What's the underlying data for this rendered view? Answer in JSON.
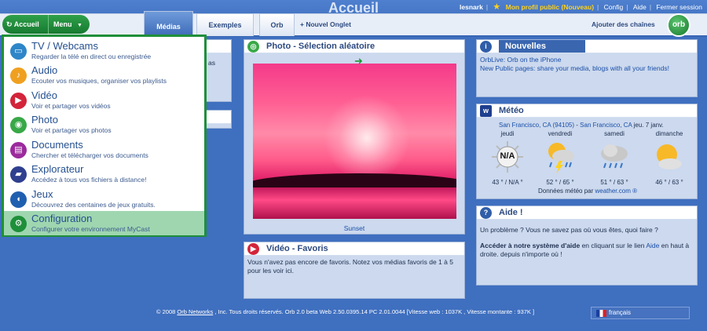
{
  "header": {
    "title": "Accueil",
    "user": "lesnark",
    "profile": "Mon profil public (Nouveau)",
    "links": [
      "Config",
      "Aide",
      "Fermer session"
    ],
    "accueil_label": "Accueil",
    "menu_label": "Menu",
    "tabs": [
      "Médias",
      "Exemples",
      "Orb"
    ],
    "new_tab": "+ Nouvel Onglet",
    "channels": "Ajouter des chaînes",
    "logo": "orb"
  },
  "menu": {
    "items": [
      {
        "title": "TV / Webcams",
        "desc": "Regarder la télé en direct ou enregistrée",
        "icon": "tv-icon",
        "color": "#2e86c8"
      },
      {
        "title": "Audio",
        "desc": "Ecouter vos musiques, organiser vos playlists",
        "icon": "music-icon",
        "color": "#f0a020"
      },
      {
        "title": "Vidéo",
        "desc": "Voir et partager vos vidéos",
        "icon": "film-icon",
        "color": "#d3243a"
      },
      {
        "title": "Photo",
        "desc": "Voir et partager vos photos",
        "icon": "camera-icon",
        "color": "#38a847"
      },
      {
        "title": "Documents",
        "desc": "Chercher et télécharger vos documents",
        "icon": "document-icon",
        "color": "#9b2a9c"
      },
      {
        "title": "Explorateur",
        "desc": "Accédez à tous vos fichiers à distance!",
        "icon": "folder-icon",
        "color": "#2f3f8f"
      },
      {
        "title": "Jeux",
        "desc": "Découvrez des centaines de jeux gratuits.",
        "icon": "pacman-icon",
        "color": "#1f5fb0"
      },
      {
        "title": "Configuration",
        "desc": "Configurer votre environnement MyCast",
        "icon": "gear-icon",
        "color": "#1f8f3a"
      }
    ]
  },
  "left_stub": {
    "text": "as"
  },
  "photo_panel": {
    "title": "Photo - Sélection aléatoire",
    "caption": "Sunset"
  },
  "video_panel": {
    "title": "Vidéo - Favoris",
    "text": "Vous n'avez pas encore de favoris. Notez vos médias favoris de 1 à 5 pour les voir ici."
  },
  "news_panel": {
    "title": "Nouvelles",
    "items": [
      "OrbLive: Orb on the iPhone",
      "New Public pages: share your media, blogs with all your friends!"
    ]
  },
  "weather_panel": {
    "title": "Météo",
    "location_link": "San Francisco, CA (94105)",
    "location_sep": " - ",
    "location_name": "San Francisco, CA",
    "date": " jeu. 7 janv.",
    "days": [
      {
        "name": "jeudi",
        "temp": "43 ° / N/A °",
        "icon": "na-icon",
        "na": "N/A"
      },
      {
        "name": "vendredi",
        "temp": "52 ° / 65 °",
        "icon": "storm-sun-icon"
      },
      {
        "name": "samedi",
        "temp": "51 ° / 63 °",
        "icon": "rain-cloud-icon"
      },
      {
        "name": "dimanche",
        "temp": "46 ° / 63 °",
        "icon": "sun-cloud-icon"
      }
    ],
    "credit_prefix": "Données météo par ",
    "credit_link": "weather.com ®"
  },
  "help_panel": {
    "title": "Aide !",
    "line1": "Un problème ? Vous ne savez pas où vous êtes, quoi faire ?",
    "line2_bold": "Accéder à notre système d'aide",
    "line2_rest": " en cliquant sur le lien ",
    "line2_link": "Aide",
    "line2_end": " en haut à droite. depuis n'importe où !"
  },
  "footer": {
    "text_before": "© 2008  ",
    "text_link": "Orb Networks",
    "text_after": " , Inc. Tous droits réservés. Orb 2.0 beta  Web 2.50.0395.14  PC 2.01.0044  [Vitesse web :  1037K  , Vitesse montante :  937K  ]",
    "lang": "français"
  }
}
